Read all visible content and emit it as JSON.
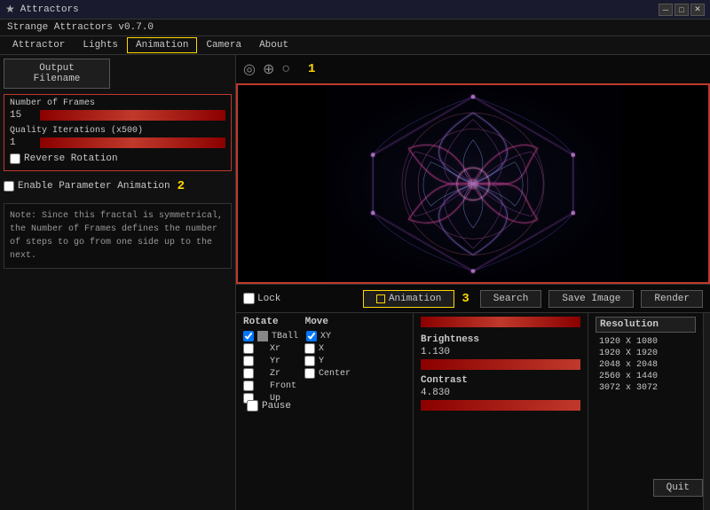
{
  "titlebar": {
    "icon": "★",
    "title": "Attractors",
    "btn_min": "─",
    "btn_max": "□",
    "btn_close": "✕"
  },
  "app": {
    "version_label": "Strange Attractors v0.7.0"
  },
  "menubar": {
    "items": [
      {
        "label": "Attractor",
        "active": false
      },
      {
        "label": "Lights",
        "active": false
      },
      {
        "label": "Animation",
        "active": true
      },
      {
        "label": "Camera",
        "active": false
      },
      {
        "label": "About",
        "active": false
      }
    ]
  },
  "left_panel": {
    "output_btn": "Output Filename",
    "frames_label": "Number of Frames",
    "frames_value": "15",
    "quality_label": "Quality Iterations (x500)",
    "quality_value": "1",
    "reverse_label": "Reverse Rotation",
    "enable_anim_label": "Enable Parameter Animation",
    "note_text": "Note: Since this fractal is symmetrical, the Number of Frames defines the number of steps to go  from one side up to the next."
  },
  "camera_controls": {
    "icons": [
      "◎",
      "⊕",
      "○"
    ]
  },
  "bottom_controls": {
    "lock_label": "Lock",
    "animation_label": "Animation",
    "search_label": "Search",
    "save_image_label": "Save Image",
    "render_label": "Render",
    "pause_label": "Pause"
  },
  "rotate_move": {
    "rotate_header": "Rotate",
    "move_header": "Move",
    "rows": [
      {
        "rotate": "TBall",
        "move": "XY",
        "rotate_checked": true,
        "move_checked": true
      },
      {
        "rotate": "Xr",
        "move": "X",
        "rotate_checked": false,
        "move_checked": false
      },
      {
        "rotate": "Yr",
        "move": "Y",
        "rotate_checked": false,
        "move_checked": false
      },
      {
        "rotate": "Zr",
        "move": "Center",
        "rotate_checked": false,
        "move_checked": false
      },
      {
        "rotate": "Front",
        "move": "",
        "rotate_checked": false,
        "move_checked": false
      },
      {
        "rotate": "Up",
        "move": "",
        "rotate_checked": false,
        "move_checked": false
      }
    ]
  },
  "sliders": {
    "brightness_label": "Brightness",
    "brightness_value": "1.130",
    "contrast_label": "Contrast",
    "contrast_value": "4.830"
  },
  "resolution": {
    "title": "Resolution",
    "options": [
      "1920 X 1080",
      "1920 X 1920",
      "2048 x 2048",
      "2560 x 1440",
      "3072 x 3072"
    ]
  },
  "quit_btn": "Quit",
  "annotations": {
    "one": "1",
    "two": "2",
    "three": "3"
  }
}
